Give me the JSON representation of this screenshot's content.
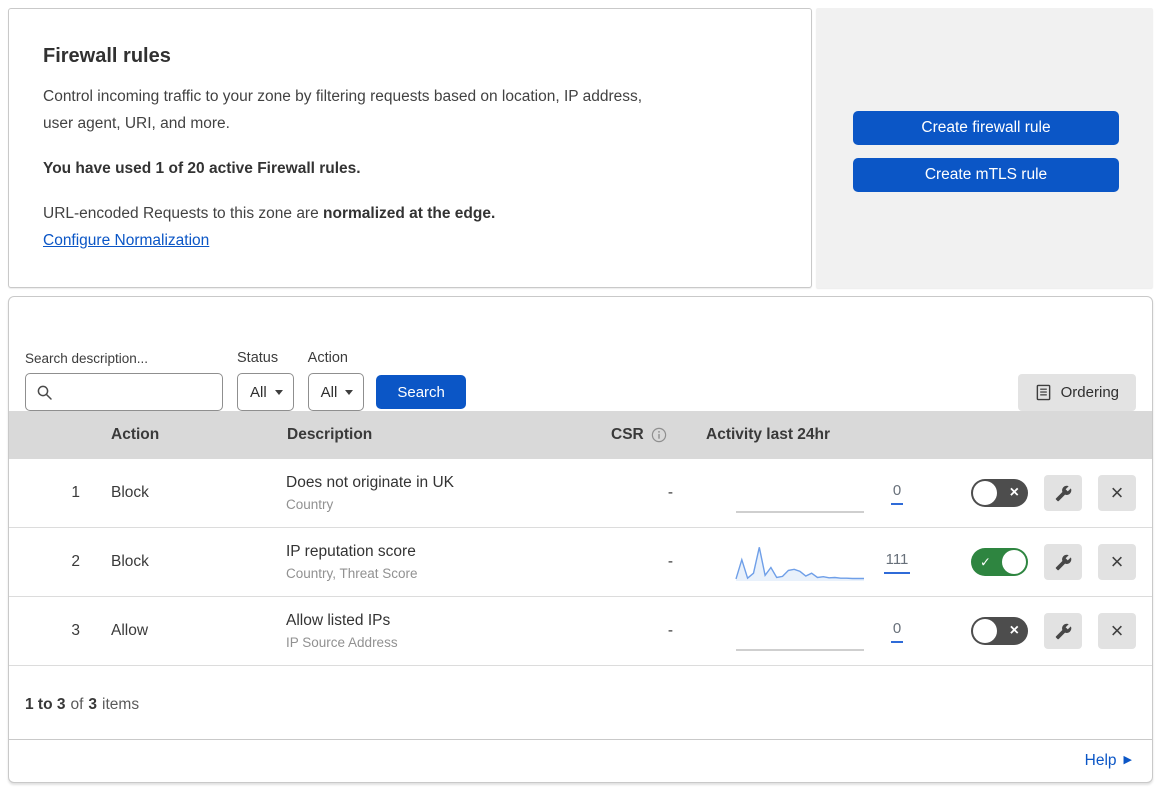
{
  "header": {
    "title": "Firewall rules",
    "description_line1": "Control incoming traffic to your zone by filtering requests based on location, IP address,",
    "description_line2": "user agent, URI, and more.",
    "usage_note": "You have used 1 of 20 active Firewall rules.",
    "normalization_prefix": "URL-encoded Requests to this zone are ",
    "normalization_bold": "normalized at the edge.",
    "normalization_link": "Configure Normalization",
    "create_firewall_button": "Create firewall rule",
    "create_mtls_button": "Create mTLS rule"
  },
  "filters": {
    "search_label": "Search description...",
    "status_label": "Status",
    "status_value": "All",
    "action_label": "Action",
    "action_value": "All",
    "search_button": "Search",
    "ordering_button": "Ordering"
  },
  "table": {
    "columns": {
      "action": "Action",
      "description": "Description",
      "csr": "CSR",
      "activity": "Activity last 24hr"
    },
    "rows": [
      {
        "number": "1",
        "action": "Block",
        "description": "Does not originate in UK",
        "criteria": "Country",
        "csr": "-",
        "count": "0",
        "enabled": false,
        "sparkline": []
      },
      {
        "number": "2",
        "action": "Block",
        "description": "IP reputation score",
        "criteria": "Country, Threat Score",
        "csr": "-",
        "count": "111",
        "enabled": true,
        "sparkline": [
          6,
          60,
          8,
          22,
          95,
          16,
          38,
          10,
          13,
          30,
          33,
          27,
          14,
          22,
          10,
          12,
          9,
          10,
          8,
          8,
          7,
          7,
          7
        ]
      },
      {
        "number": "3",
        "action": "Allow",
        "description": "Allow listed IPs",
        "criteria": "IP Source Address",
        "csr": "-",
        "count": "0",
        "enabled": false,
        "sparkline": []
      }
    ]
  },
  "footer": {
    "range": "1 to 3",
    "of": "of",
    "total": "3",
    "items_label": "items",
    "help": "Help"
  },
  "icons": {
    "close_glyph": "×",
    "check_glyph": "✓",
    "help_arrow_glyph": "▶"
  },
  "colors": {
    "primary_blue": "#0b56c6",
    "toggle_on_green": "#2e8540",
    "toggle_off_gray": "#4d4d4d",
    "header_band_gray": "#d9d9d9",
    "sparkline_line": "#6f9fe8",
    "sparkline_fill": "#e9f1fb",
    "flatline": "#bfbfbf",
    "count_underline": "#2f6bd8"
  }
}
